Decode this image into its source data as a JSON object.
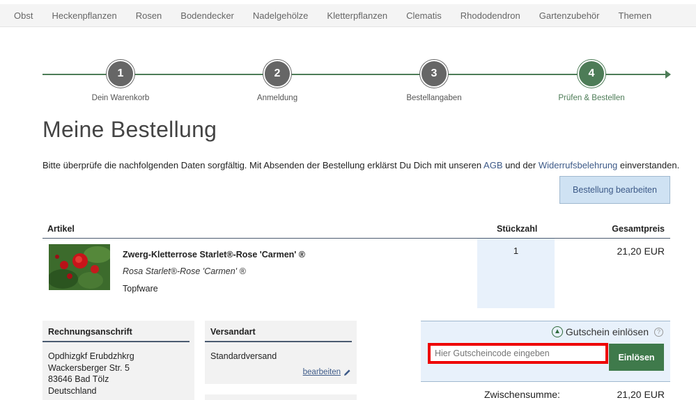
{
  "nav": {
    "items": [
      "Obst",
      "Heckenpflanzen",
      "Rosen",
      "Bodendecker",
      "Nadelgehölze",
      "Kletterpflanzen",
      "Clematis",
      "Rhododendron",
      "Gartenzubehör",
      "Themen"
    ]
  },
  "steps": [
    {
      "number": "1",
      "label": "Dein Warenkorb"
    },
    {
      "number": "2",
      "label": "Anmeldung"
    },
    {
      "number": "3",
      "label": "Bestellangaben"
    },
    {
      "number": "4",
      "label": "Prüfen & Bestellen"
    }
  ],
  "page": {
    "title": "Meine Bestellung",
    "intro_before": "Bitte überprüfe die nachfolgenden Daten sorgfältig. Mit Absenden der Bestellung erklärst Du Dich mit unseren ",
    "agb_link": "AGB",
    "intro_middle": " und der ",
    "withdrawal_link": "Widerrufsbelehrung",
    "intro_after": " einverstanden.",
    "edit_order_button": "Bestellung bearbeiten"
  },
  "table": {
    "headers": {
      "article": "Artikel",
      "quantity": "Stückzahl",
      "total": "Gesamtpreis"
    },
    "product": {
      "name": "Zwerg-Kletterrose Starlet®-Rose 'Carmen' ®",
      "latin": "Rosa Starlet®-Rose 'Carmen' ®",
      "pot": "Topfware",
      "quantity": "1",
      "price": "21,20 EUR"
    }
  },
  "billing": {
    "title": "Rechnungsanschrift",
    "lines": [
      "Opdhizgkf Erubdzhkrg",
      "Wackersberger Str. 5",
      "83646 Bad Tölz",
      "Deutschland"
    ]
  },
  "shipping": {
    "title": "Versandart",
    "method": "Standardversand",
    "edit_link": "bearbeiten"
  },
  "voucher": {
    "title": "Gutschein einlösen",
    "placeholder": "Hier Gutscheincode eingeben",
    "button": "Einlösen"
  },
  "summary": {
    "subtotal_label": "Zwischensumme:",
    "subtotal_value": "21,20 EUR"
  },
  "colors": {
    "accent_green": "#4d7c57",
    "step_gray": "#666666",
    "link_blue": "#3d5a88",
    "highlight_red": "#ee0000"
  }
}
